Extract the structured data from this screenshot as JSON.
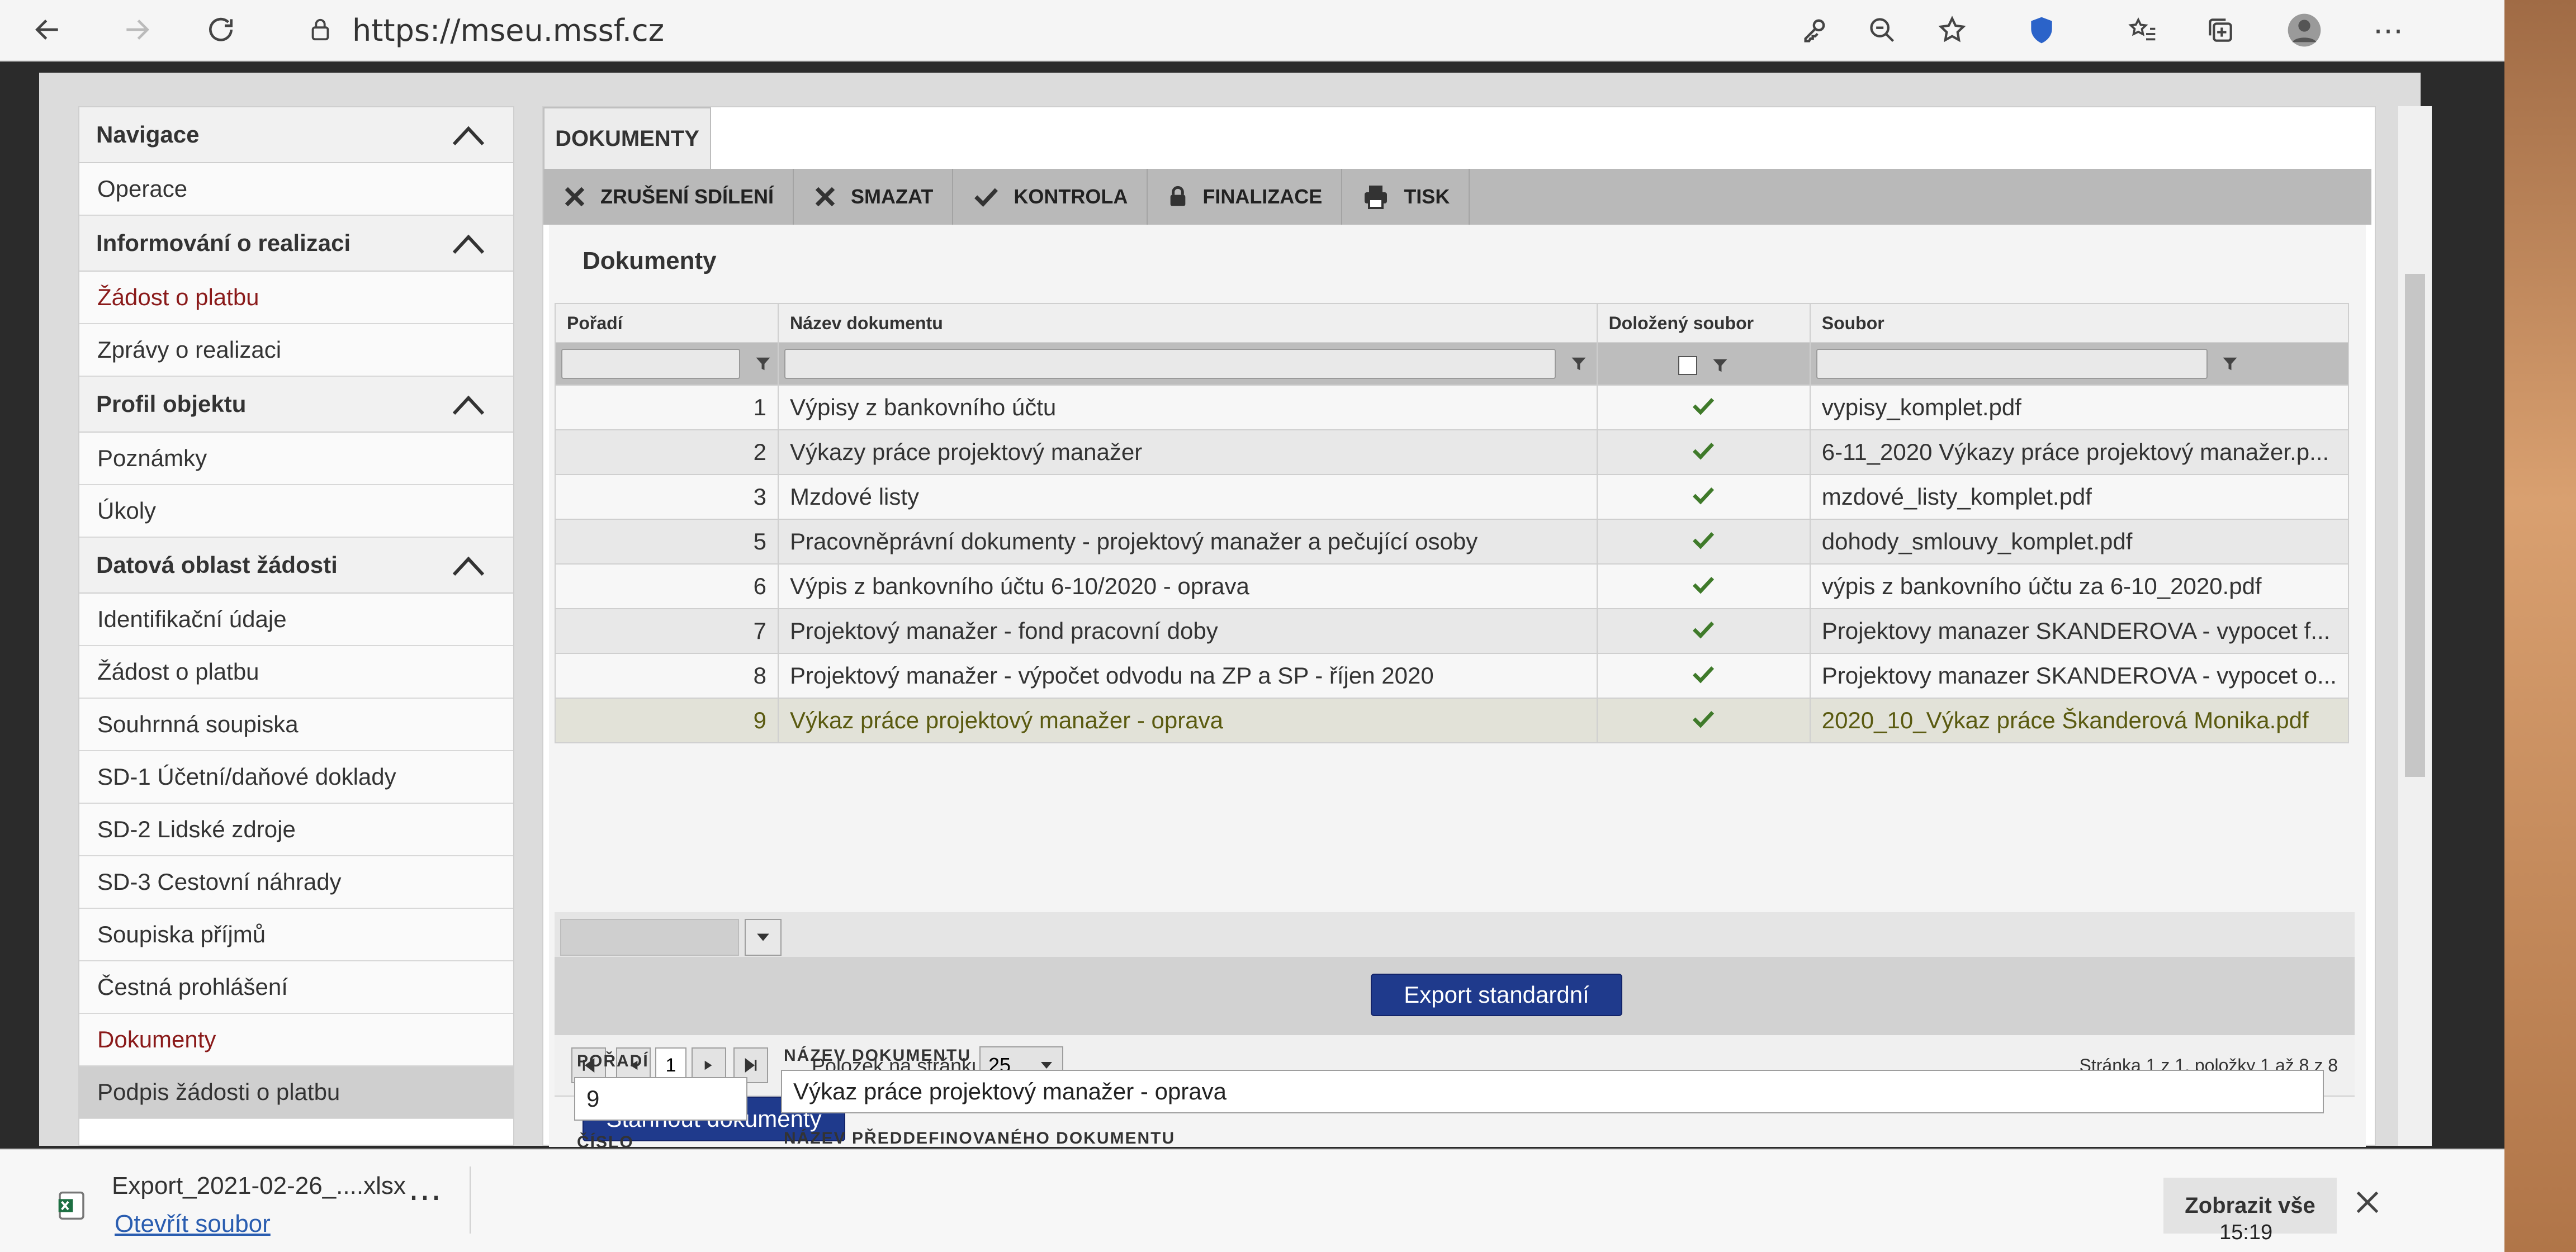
{
  "browser": {
    "url": "https://mseu.mssf.cz"
  },
  "sidebar": {
    "sections": [
      {
        "title": "Navigace",
        "items": [
          {
            "label": "Operace",
            "style": "normal"
          }
        ]
      },
      {
        "title": "Informování o realizaci",
        "items": [
          {
            "label": "Žádost o platbu",
            "style": "red"
          },
          {
            "label": "Zprávy o realizaci",
            "style": "normal"
          }
        ]
      },
      {
        "title": "Profil objektu",
        "items": [
          {
            "label": "Poznámky",
            "style": "normal"
          },
          {
            "label": "Úkoly",
            "style": "normal"
          }
        ]
      },
      {
        "title": "Datová oblast žádosti",
        "items": [
          {
            "label": "Identifikační údaje",
            "style": "normal"
          },
          {
            "label": "Žádost o platbu",
            "style": "normal"
          },
          {
            "label": "Souhrnná soupiska",
            "style": "normal"
          },
          {
            "label": "SD-1 Účetní/daňové doklady",
            "style": "normal"
          },
          {
            "label": "SD-2 Lidské zdroje",
            "style": "normal"
          },
          {
            "label": "SD-3 Cestovní náhrady",
            "style": "normal"
          },
          {
            "label": "Soupiska příjmů",
            "style": "normal"
          },
          {
            "label": "Čestná prohlášení",
            "style": "normal"
          },
          {
            "label": "Dokumenty",
            "style": "red"
          },
          {
            "label": "Podpis žádosti o platbu",
            "style": "gray"
          }
        ]
      }
    ]
  },
  "content": {
    "tab": "DOKUMENTY",
    "toolbar": [
      {
        "label": "ZRUŠENÍ SDÍLENÍ",
        "icon": "x-icon"
      },
      {
        "label": "SMAZAT",
        "icon": "x-icon"
      },
      {
        "label": "KONTROLA",
        "icon": "check-icon"
      },
      {
        "label": "FINALIZACE",
        "icon": "lock-icon"
      },
      {
        "label": "TISK",
        "icon": "printer-icon"
      }
    ],
    "panel_title": "Dokumenty",
    "columns": [
      "Pořadí",
      "Název dokumentu",
      "Doložený soubor",
      "Soubor"
    ],
    "rows": [
      {
        "order": "1",
        "name": "Výpisy z bankovního účtu",
        "file": "vypisy_komplet.pdf"
      },
      {
        "order": "2",
        "name": "Výkazy práce projektový manažer",
        "file": "6-11_2020 Výkazy práce projektový manažer.p..."
      },
      {
        "order": "3",
        "name": "Mzdové listy",
        "file": "mzdové_listy_komplet.pdf"
      },
      {
        "order": "5",
        "name": "Pracovněprávní dokumenty - projektový manažer a pečující osoby",
        "file": "dohody_smlouvy_komplet.pdf"
      },
      {
        "order": "6",
        "name": "Výpis z bankovního účtu 6-10/2020 - oprava",
        "file": "výpis z bankovního účtu za 6-10_2020.pdf"
      },
      {
        "order": "7",
        "name": "Projektový manažer - fond pracovní doby",
        "file": "Projektovy manazer SKANDEROVA - vypocet f..."
      },
      {
        "order": "8",
        "name": "Projektový manažer - výpočet odvodu na ZP a SP - říjen 2020",
        "file": "Projektovy manazer SKANDEROVA - vypocet o..."
      },
      {
        "order": "9",
        "name": "Výkaz práce projektový manažer - oprava",
        "file": "2020_10_Výkaz práce Škanderová Monika.pdf"
      }
    ],
    "export_button": "Export standardní",
    "pager": {
      "current_page": "1",
      "per_page_label": "Položek na stránku",
      "per_page_value": "25",
      "summary": "Stránka 1 z 1, položky 1 až 8 z 8"
    },
    "download_button": "Stáhnout dokumenty",
    "detail": {
      "order_label": "POŘADÍ",
      "order_value": "9",
      "name_label": "NÁZEV DOKUMENTU",
      "name_value": "Výkaz práce projektový manažer - oprava",
      "number_label": "ČÍSLO",
      "predefined_label": "NÁZEV PŘEDDEFINOVANÉHO DOKUMENTU"
    }
  },
  "download_bar": {
    "file_name": "Export_2021-02-26_....xlsx",
    "open_label": "Otevřít soubor",
    "show_all": "Zobrazit vše",
    "clock": "15:19"
  },
  "colors": {
    "link_red": "#8a1a1a",
    "button_blue": "#1f3a8c",
    "check_green": "#3f7a2a"
  }
}
